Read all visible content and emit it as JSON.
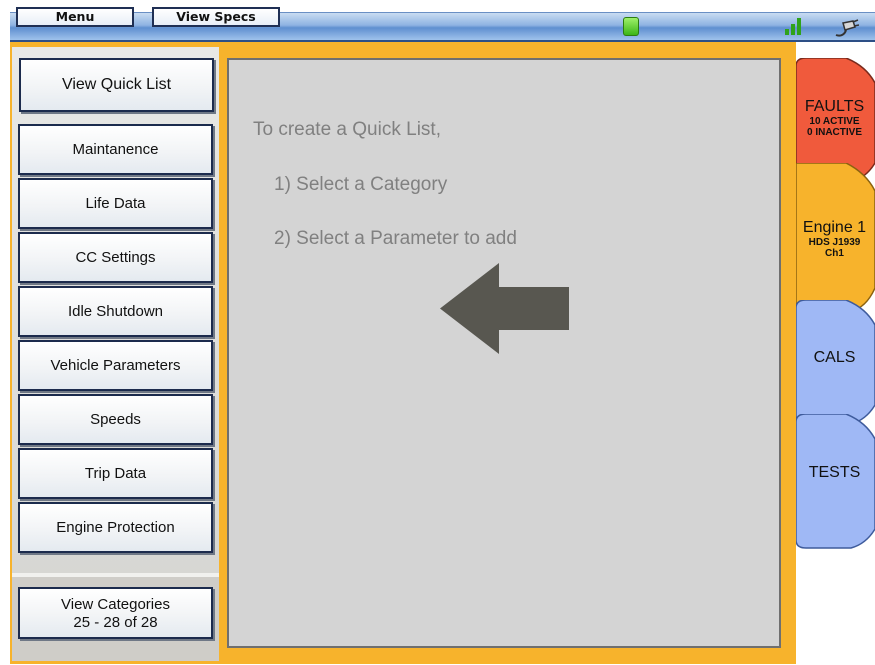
{
  "toolbar": {
    "menu_label": "Menu",
    "specs_label": "View Specs"
  },
  "status": {
    "led_color": "#3bb517",
    "signal_icon": "signal-bars-icon",
    "plug_icon": "plug-icon"
  },
  "sidebar": {
    "quick_list_label": "View Quick List",
    "categories": [
      "Maintanence",
      "Life Data",
      "CC Settings",
      "Idle Shutdown",
      "Vehicle Parameters",
      "Speeds",
      "Trip Data",
      "Engine Protection"
    ],
    "view_categories": {
      "line1": "View Categories",
      "line2": "25 - 28 of 28"
    }
  },
  "panel": {
    "intro": "To create a Quick List,",
    "step1": "1) Select a Category",
    "step2": "2) Select a Parameter to add",
    "arrow_icon": "arrow-left-icon"
  },
  "tabs": {
    "faults": {
      "title": "FAULTS",
      "active": "10 ACTIVE",
      "inactive": "0 INACTIVE",
      "color": "#f05a3c"
    },
    "engine": {
      "title": "Engine 1",
      "protocol": "HDS J1939",
      "channel": "Ch1",
      "color": "#f7b32c"
    },
    "cals": {
      "title": "CALS",
      "color": "#9fb8f5"
    },
    "tests": {
      "title": "TESTS",
      "color": "#9fb8f5"
    }
  },
  "colors": {
    "frame": "#f7b32c",
    "panel_bg": "#d4d4d4"
  }
}
